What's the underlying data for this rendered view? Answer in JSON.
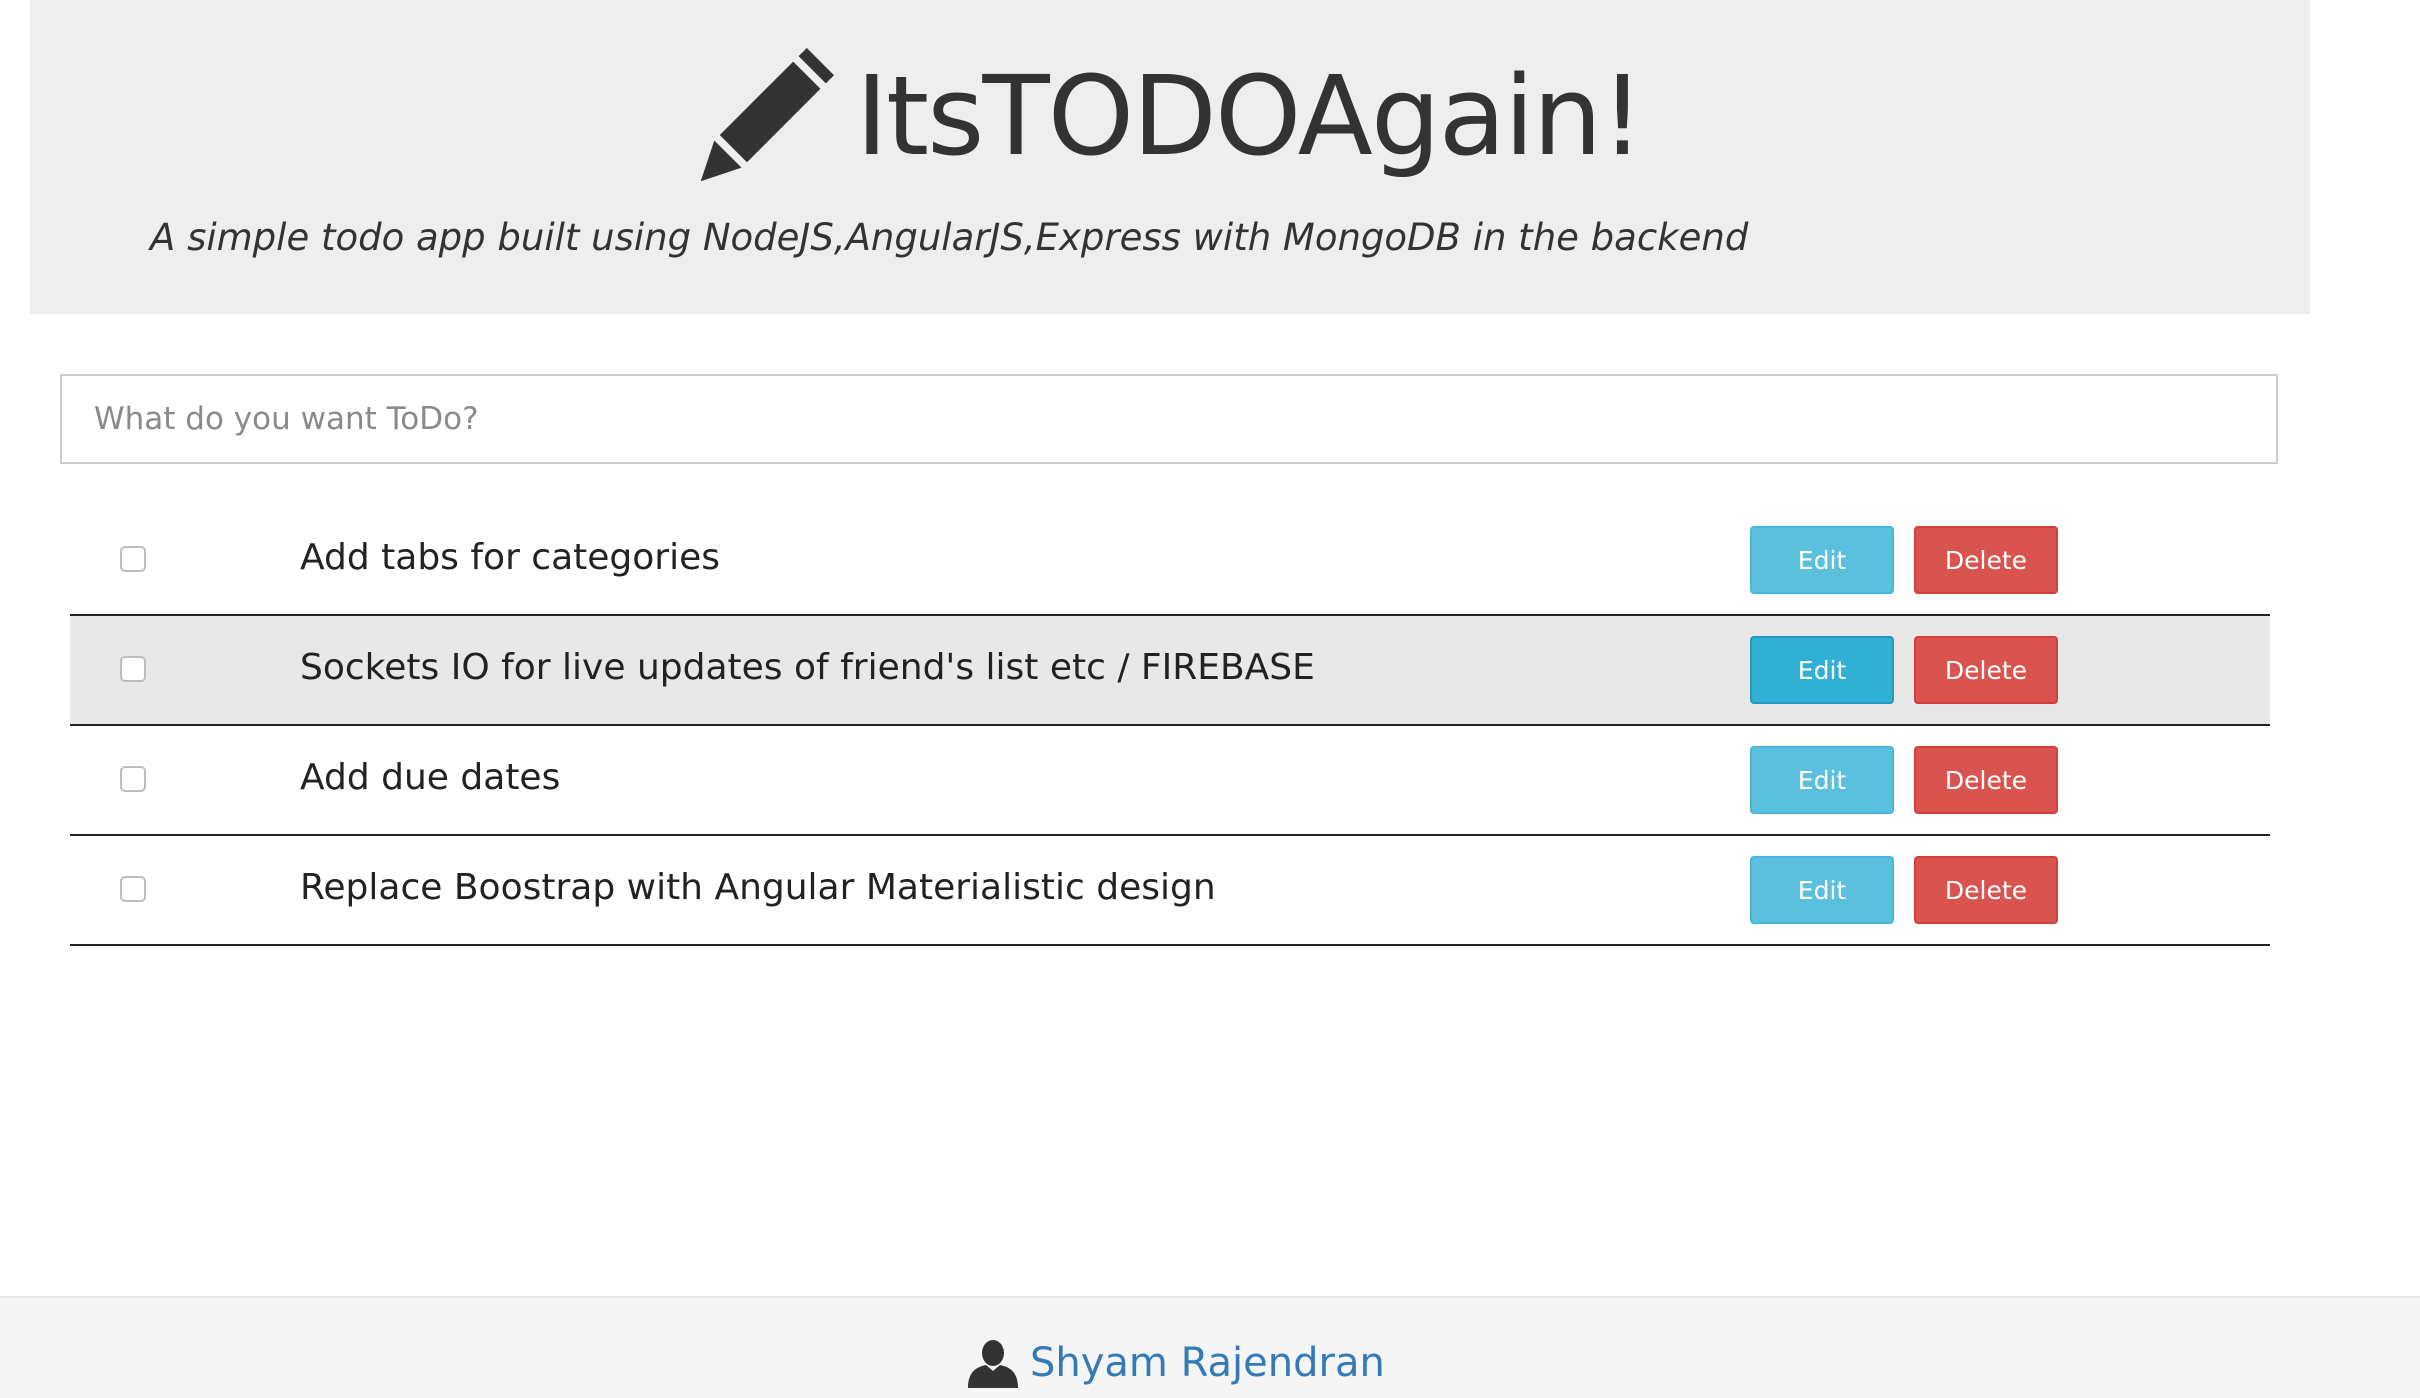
{
  "header": {
    "title": "ItsTODOAgain!",
    "subtitle": "A simple todo app built using NodeJS,AngularJS,Express with MongoDB in the backend",
    "icon": "pencil-icon"
  },
  "new_todo": {
    "placeholder": "What do you want ToDo?",
    "value": ""
  },
  "todos": [
    {
      "text": "Add tabs for categories",
      "checked": false,
      "edit_label": "Edit",
      "delete_label": "Delete"
    },
    {
      "text": "Sockets IO for live updates of friend's list etc / FIREBASE",
      "checked": false,
      "edit_label": "Edit",
      "delete_label": "Delete",
      "hovered": true
    },
    {
      "text": "Add due dates",
      "checked": false,
      "edit_label": "Edit",
      "delete_label": "Delete"
    },
    {
      "text": "Replace Boostrap with Angular Materialistic design",
      "checked": false,
      "edit_label": "Edit",
      "delete_label": "Delete"
    }
  ],
  "footer": {
    "author": "Shyam Rajendran",
    "icon": "user-icon"
  },
  "colors": {
    "edit": "#5bc0de",
    "edit_active": "#31b0d5",
    "delete": "#d9534f",
    "link": "#337ab7",
    "header_bg": "#eeeeee"
  }
}
